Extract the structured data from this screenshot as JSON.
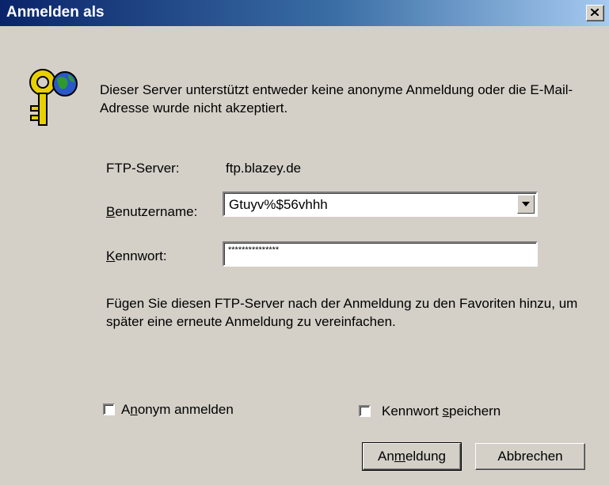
{
  "window": {
    "title": "Anmelden als"
  },
  "message": "Dieser Server unterstützt entweder keine anonyme Anmeldung oder die E-Mail-Adresse wurde nicht akzeptiert.",
  "ftp_server": {
    "label": "FTP-Server:",
    "value": "ftp.blazey.de"
  },
  "username": {
    "label_u": "B",
    "label_rest": "enutzername:",
    "value": "Gtuyv%$56vhhh"
  },
  "password": {
    "label_u": "K",
    "label_rest": "ennwort:",
    "value": "***************"
  },
  "info": "Fügen Sie diesen FTP-Server nach der Anmeldung zu den Favoriten hinzu, um später eine erneute Anmeldung zu vereinfachen.",
  "checkboxes": {
    "anonymous": {
      "pre": "A",
      "u": "n",
      "post": "onym anmelden",
      "checked": false
    },
    "save_password": {
      "pre": "Kennwort ",
      "u": "s",
      "post": "peichern",
      "checked": false
    }
  },
  "buttons": {
    "login": {
      "pre": "An",
      "u": "m",
      "post": "eldung"
    },
    "cancel": "Abbrechen"
  },
  "icons": {
    "title_close": "close-icon",
    "dialog": "key-globe-icon"
  }
}
